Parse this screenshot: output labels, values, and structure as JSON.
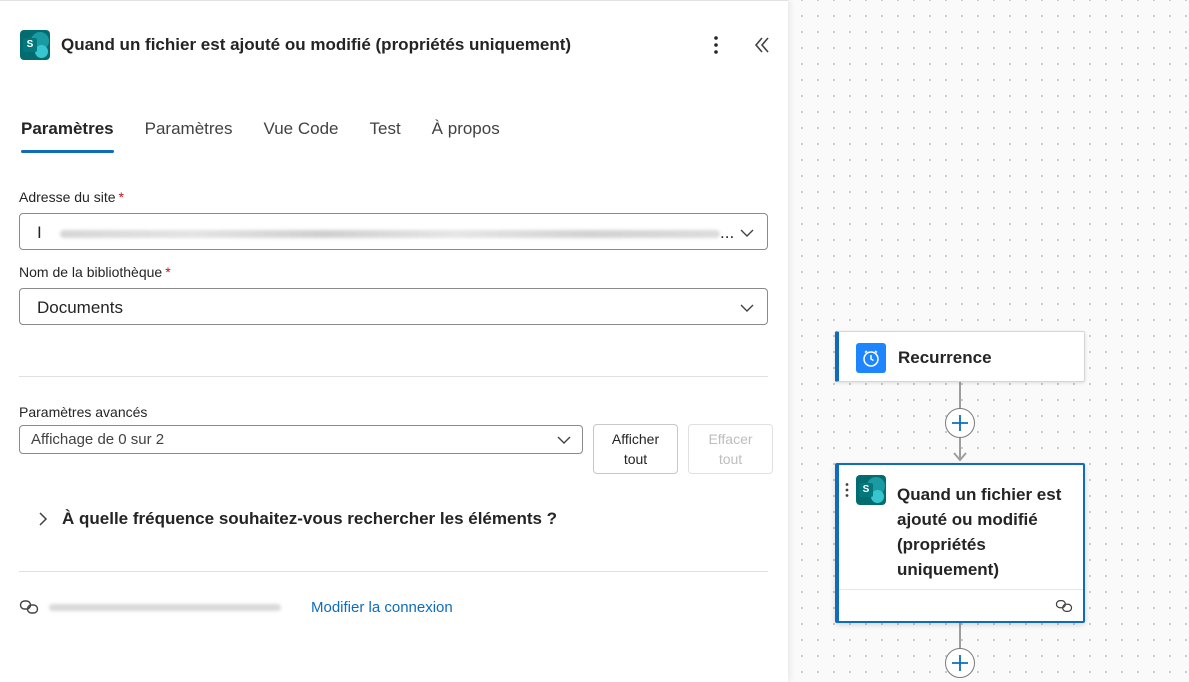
{
  "panel": {
    "title": "Quand un fichier est ajouté ou modifié (propriétés uniquement)",
    "more_icon": "more-vertical-icon",
    "collapse_icon": "double-chevron-left-icon",
    "tabs": [
      {
        "label": "Paramètres",
        "active": true
      },
      {
        "label": "Paramètres",
        "active": false
      },
      {
        "label": "Vue Code",
        "active": false
      },
      {
        "label": "Test",
        "active": false
      },
      {
        "label": "À propos",
        "active": false
      }
    ],
    "site_address": {
      "label": "Adresse du site",
      "required_mark": "*",
      "value_prefix": "I",
      "value_suffix": "..."
    },
    "library_name": {
      "label": "Nom de la bibliothèque",
      "required_mark": "*",
      "value": "Documents"
    },
    "advanced": {
      "label": "Paramètres avancés",
      "value": "Affichage de 0 sur 2",
      "show_all_line1": "Afficher",
      "show_all_line2": "tout",
      "clear_line1": "Effacer",
      "clear_line2": "tout"
    },
    "frequency_section": "À quelle fréquence souhaitez-vous rechercher les éléments ?",
    "connection": {
      "link": "Modifier la connexion"
    }
  },
  "canvas": {
    "recurrence_card": {
      "title": "Recurrence",
      "icon": "clock-icon"
    },
    "trigger_card": {
      "title": "Quand un fichier est ajouté ou modifié (propriétés uniquement)",
      "icon": "sharepoint-icon"
    }
  },
  "colors": {
    "accent": "#0f6cbd",
    "sharepoint": "#036c70",
    "required": "#c50f1f",
    "recurrence_icon_bg": "#1f85ff"
  }
}
